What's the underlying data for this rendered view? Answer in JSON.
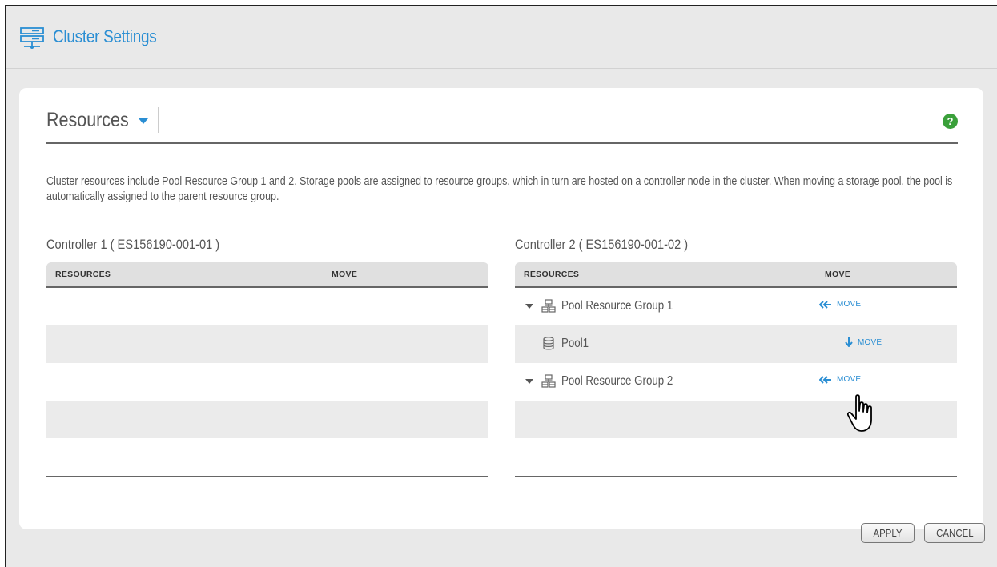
{
  "window": {
    "title": "Cluster Settings",
    "title_icon": "server-cluster-icon",
    "accent_color": "#2a8ed3"
  },
  "resources": {
    "header_label": "Resources",
    "help_label": "?",
    "description": "Cluster resources include Pool Resource Group 1 and 2. Storage pools are assigned to resource groups, which in turn are hosted on a controller node in the cluster. When moving a storage pool, the pool is automatically assigned to the parent resource group."
  },
  "controllers": [
    {
      "title": "Controller 1 ( ES156190-001-01 )",
      "col_resources": "RESOURCES",
      "col_move": "MOVE",
      "rows": []
    },
    {
      "title": "Controller 2 ( ES156190-001-02 )",
      "col_resources": "RESOURCES",
      "col_move": "MOVE",
      "rows": [
        {
          "label": "Pool Resource Group 1",
          "type": "group",
          "move": "MOVE",
          "move_direction": "left"
        },
        {
          "label": "Pool1",
          "type": "pool",
          "move": "MOVE",
          "move_direction": "down"
        },
        {
          "label": "Pool Resource Group 2",
          "type": "group",
          "move": "MOVE",
          "move_direction": "left"
        }
      ]
    }
  ],
  "buttons": {
    "apply": "APPLY",
    "cancel": "CANCEL"
  }
}
